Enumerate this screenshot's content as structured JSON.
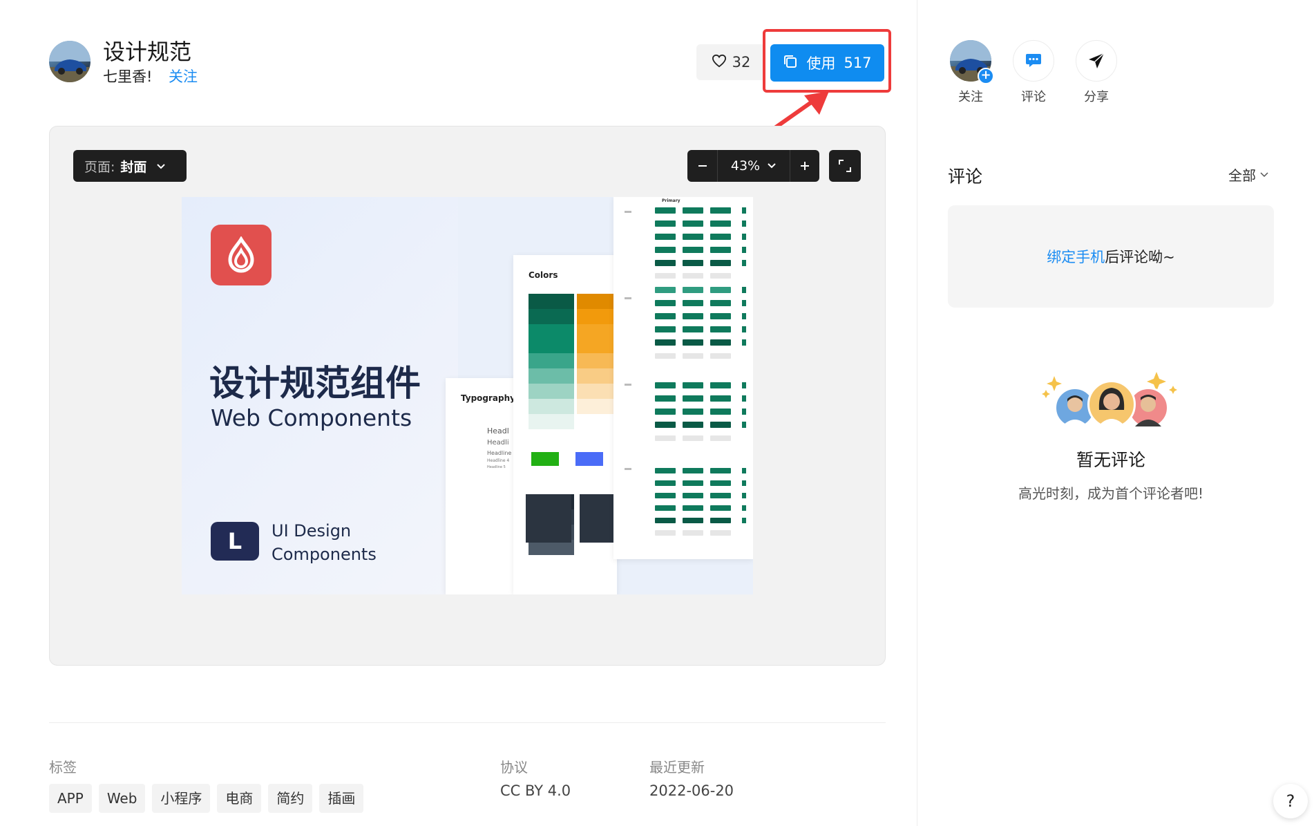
{
  "header": {
    "title": "设计规范",
    "author": "七里香!",
    "follow_label": "关注",
    "like_count": "32",
    "use_label": "使用",
    "use_count": "517"
  },
  "preview": {
    "page_label": "页面:",
    "page_value": "封面",
    "zoom": "43%",
    "cover": {
      "title": "设计规范组件",
      "subtitle": "Web Components",
      "ui_line1": "UI Design",
      "ui_line2": "Components",
      "logo_letter": "L",
      "colors_label": "Colors",
      "typography_label": "Typography",
      "primary_label": "Primary",
      "headings": [
        "Headl",
        "Headli",
        "Headline",
        "Headline 4",
        "Headline 5"
      ]
    }
  },
  "meta": {
    "tags_label": "标签",
    "tags": [
      "APP",
      "Web",
      "小程序",
      "电商",
      "简约",
      "插画"
    ],
    "license_label": "协议",
    "license_value": "CC BY 4.0",
    "updated_label": "最近更新",
    "updated_value": "2022-06-20"
  },
  "sidebar": {
    "actions": [
      {
        "label": "关注",
        "icon": "avatar-plus-icon"
      },
      {
        "label": "评论",
        "icon": "chat-bubble-icon"
      },
      {
        "label": "分享",
        "icon": "send-icon"
      }
    ],
    "comments_title": "评论",
    "filter_label": "全部",
    "bind_link": "绑定手机",
    "bind_text": "后评论呦~",
    "empty_title": "暂无评论",
    "empty_sub": "高光时刻，成为首个评论者吧!",
    "help": "?"
  },
  "colors": {
    "accent_blue": "#0f8cf0",
    "highlight_red": "#ee3b3b",
    "link_blue": "#1b8cf2",
    "cover_red": "#e1504e",
    "cover_navy": "#222b55",
    "teal": "#0a7a5c",
    "orange": "#f29a0c"
  }
}
